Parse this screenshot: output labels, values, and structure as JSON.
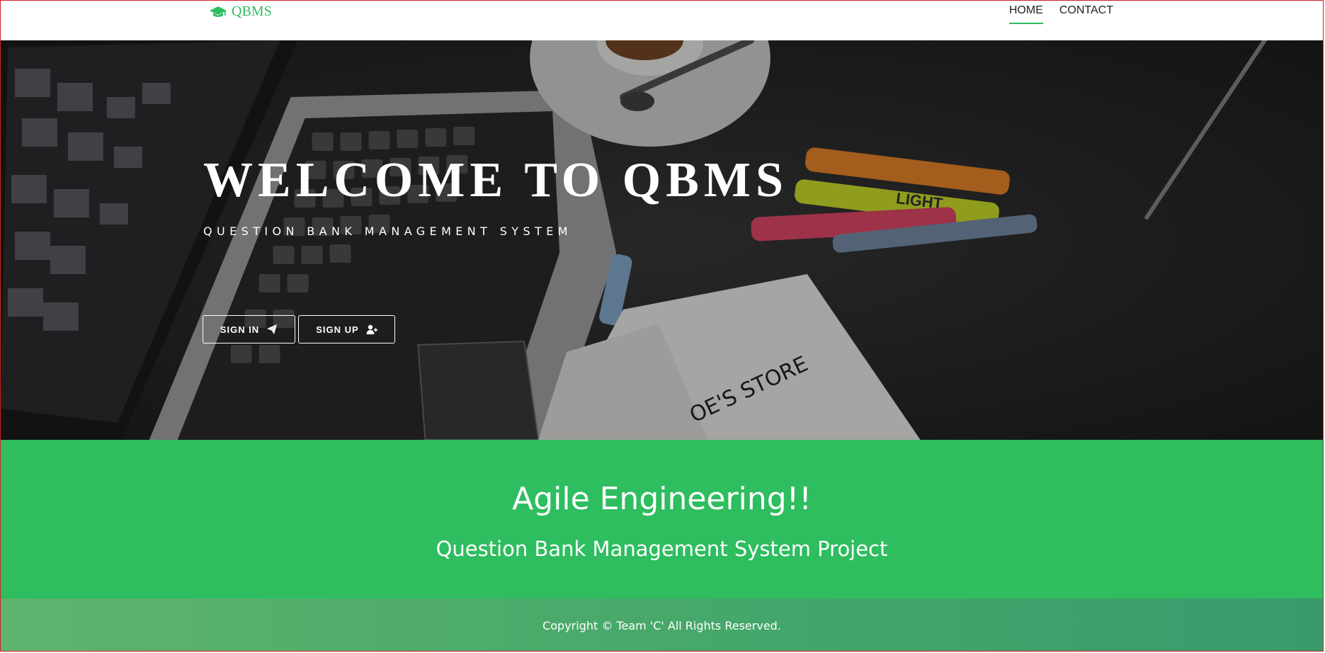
{
  "navbar": {
    "brand": "QBMS",
    "links": [
      {
        "label": "HOME",
        "active": true
      },
      {
        "label": "CONTACT",
        "active": false
      }
    ]
  },
  "hero": {
    "title": "WELCOME TO QBMS",
    "subtitle": "QUESTION BANK MANAGEMENT SYSTEM",
    "buttons": {
      "signin": "SIGN IN",
      "signup": "SIGN UP"
    },
    "photo_text": {
      "light": "LIGHT",
      "store": "OE'S STORE"
    }
  },
  "promo": {
    "title": "Agile Engineering!!",
    "subtitle": "Question Bank Management System Project"
  },
  "footer": {
    "copyright": "Copyright © Team 'C' All Rights Reserved."
  },
  "colors": {
    "accent": "#2ebd5f",
    "footer_start": "#5eb46f",
    "footer_end": "#3a9a6c",
    "hero_bg": "#2a2a2b"
  },
  "icons": {
    "brand": "graduation-cap-icon",
    "signin": "paper-plane-icon",
    "signup": "user-plus-icon"
  }
}
